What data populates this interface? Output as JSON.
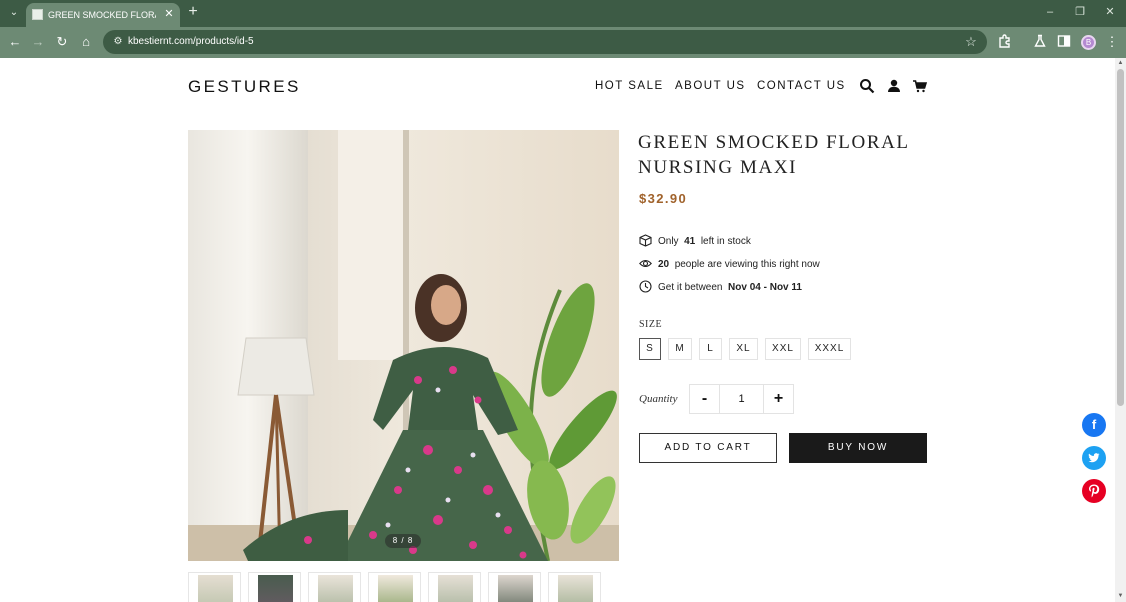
{
  "browser": {
    "tab_title": "GREEN SMOCKED FLORAL NURSING MAXI",
    "url": "kbestiernt.com/products/id-5",
    "profile_initial": "B",
    "icons": [
      "tab-search-icon",
      "close-icon",
      "plus-icon",
      "minimize-icon",
      "restore-icon",
      "close-window-icon",
      "back-icon",
      "forward-icon",
      "reload-icon",
      "home-icon",
      "site-settings-icon",
      "bookmark-star-icon",
      "extensions-icon",
      "labs-icon",
      "side-panel-icon",
      "menu-dots-icon"
    ]
  },
  "header": {
    "logo": "GESTURES",
    "nav": [
      "HOT SALE",
      "ABOUT US",
      "CONTACT US"
    ],
    "icons": [
      "search-icon",
      "account-icon",
      "cart-icon"
    ]
  },
  "gallery": {
    "counter": "8 / 8",
    "thumbnail_count": 7
  },
  "product": {
    "title": "GREEN SMOCKED FLORAL NURSING MAXI",
    "price": "$32.90",
    "stock": {
      "prefix": "Only",
      "count": "41",
      "suffix": "left in stock"
    },
    "viewers": {
      "count": "20",
      "suffix": "people are viewing this right now"
    },
    "delivery": {
      "prefix": "Get it between",
      "range": "Nov 04 - Nov 11"
    },
    "size_label": "SIZE",
    "sizes": [
      "S",
      "M",
      "L",
      "XL",
      "XXL",
      "XXXL"
    ],
    "selected_size": "S",
    "quantity_label": "Quantity",
    "quantity": "1",
    "minus": "-",
    "plus": "+",
    "add_to_cart": "ADD TO CART",
    "buy_now": "BUY NOW"
  },
  "social": [
    {
      "name": "facebook",
      "glyph": "f",
      "color": "#1877f2"
    },
    {
      "name": "twitter",
      "glyph": "t",
      "color": "#1da1f2"
    },
    {
      "name": "pinterest",
      "glyph": "p",
      "color": "#e60023"
    }
  ],
  "colors": {
    "chrome_dark": "#3d5b45",
    "chrome_light": "#6d8a74",
    "price": "#a0622b",
    "buy_button": "#1a1a1a"
  }
}
